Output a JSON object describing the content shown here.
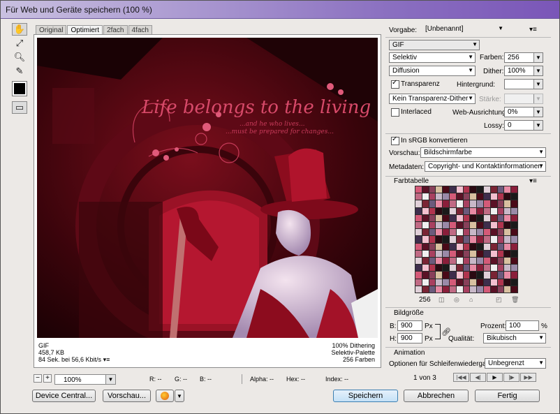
{
  "title": "Für Web und Geräte speichern (100 %)",
  "tabs": [
    "Original",
    "Optimiert",
    "2fach",
    "4fach"
  ],
  "preview_info": {
    "format": "GIF",
    "size": "458,7 KB",
    "time": "84 Sek. bei 56,6 Kbit/s",
    "dither": "100% Dithering",
    "palette": "Selektiv-Palette",
    "colors": "256 Farben"
  },
  "artwork_text": {
    "main": "Life belongs to the living",
    "line2": "...and he who lives...",
    "line3": "...must be prepared for changes..."
  },
  "status": {
    "zoom": "100%",
    "r": "R: --",
    "g": "G: --",
    "b": "B: --",
    "alpha": "Alpha: --",
    "hex": "Hex: --",
    "index": "Index: --"
  },
  "buttons": {
    "device_central": "Device Central...",
    "preview": "Vorschau...",
    "save": "Speichern",
    "cancel": "Abbrechen",
    "done": "Fertig"
  },
  "settings": {
    "preset_label": "Vorgabe:",
    "preset": "[Unbenannt]",
    "format": "GIF",
    "reduction": "Selektiv",
    "colors_label": "Farben:",
    "colors": "256",
    "dither_algo": "Diffusion",
    "dither_label": "Dither:",
    "dither": "100%",
    "transparency": "Transparenz",
    "matte_label": "Hintergrund:",
    "trans_dither": "Kein Transparenz-Dither",
    "amount_label": "Stärke:",
    "interlaced": "Interlaced",
    "websnap_label": "Web-Ausrichtung:",
    "websnap": "0%",
    "lossy_label": "Lossy:",
    "lossy": "0",
    "srgb": "In sRGB konvertieren",
    "preview_label": "Vorschau:",
    "preview": "Bildschirmfarbe",
    "meta_label": "Metadaten:",
    "meta": "Copyright- und Kontaktinformationen"
  },
  "color_table": {
    "title": "Farbtabelle",
    "count": "256"
  },
  "image_size": {
    "title": "Bildgröße",
    "w_label": "B:",
    "w": "900",
    "h_label": "H:",
    "h": "900",
    "unit": "Px",
    "percent_label": "Prozent:",
    "percent": "100",
    "percent_unit": "%",
    "quality_label": "Qualität:",
    "quality": "Bikubisch"
  },
  "animation": {
    "title": "Animation",
    "loop_label": "Optionen für Schleifenwiedergabe:",
    "loop": "Unbegrenzt",
    "frame": "1 von 3"
  },
  "colors": {
    "accent": "#7a56b8",
    "wine": "#8a0f1e"
  }
}
